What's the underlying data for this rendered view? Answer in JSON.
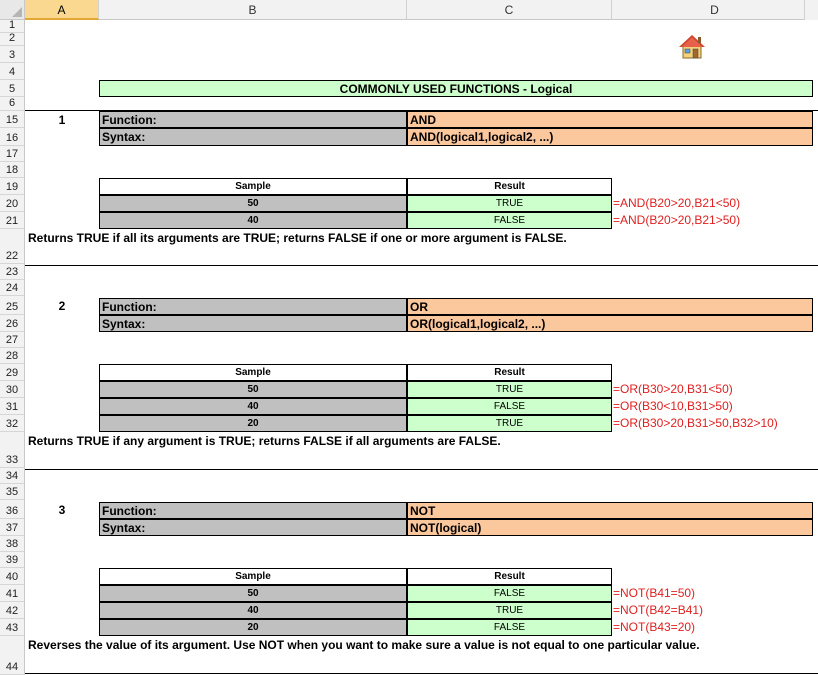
{
  "sheet": {
    "columns": [
      "A",
      "B",
      "C",
      "D"
    ],
    "selected_column": "A",
    "rows": [
      "1",
      "2",
      "3",
      "4",
      "5",
      "6",
      "15",
      "16",
      "17",
      "18",
      "19",
      "20",
      "21",
      "22",
      "23",
      "24",
      "25",
      "26",
      "27",
      "28",
      "29",
      "30",
      "31",
      "32",
      "33",
      "34",
      "35",
      "36",
      "37",
      "38",
      "39",
      "40",
      "41",
      "42",
      "43",
      "44"
    ]
  },
  "header_title": "COMMONLY USED FUNCTIONS - Logical",
  "home_icon": "house-icon",
  "labels": {
    "function": "Function:",
    "syntax": "Syntax:",
    "sample": "Sample",
    "result": "Result"
  },
  "sections": [
    {
      "number": "1",
      "function": "AND",
      "syntax": "AND(logical1,logical2, ...)",
      "rows": [
        {
          "sample": "50",
          "result": "TRUE",
          "formula": "=AND(B20>20,B21<50)"
        },
        {
          "sample": "40",
          "result": "FALSE",
          "formula": "=AND(B20>20,B21>50)"
        }
      ],
      "description": "Returns TRUE if all its arguments are TRUE; returns FALSE if one or more argument is FALSE."
    },
    {
      "number": "2",
      "function": "OR",
      "syntax": "OR(logical1,logical2, ...)",
      "rows": [
        {
          "sample": "50",
          "result": "TRUE",
          "formula": "=OR(B30>20,B31<50)"
        },
        {
          "sample": "40",
          "result": "FALSE",
          "formula": "=OR(B30<10,B31>50)"
        },
        {
          "sample": "20",
          "result": "TRUE",
          "formula": "=OR(B30>20,B31>50,B32>10)"
        }
      ],
      "description": "Returns TRUE if any argument is TRUE; returns FALSE if all arguments are FALSE."
    },
    {
      "number": "3",
      "function": "NOT",
      "syntax": "NOT(logical)",
      "rows": [
        {
          "sample": "50",
          "result": "FALSE",
          "formula": "=NOT(B41=50)"
        },
        {
          "sample": "40",
          "result": "TRUE",
          "formula": "=NOT(B42=B41)"
        },
        {
          "sample": "20",
          "result": "FALSE",
          "formula": "=NOT(B43=20)"
        }
      ],
      "description": "Reverses the value of its argument. Use NOT when you want to make sure a value is not equal to one particular value."
    }
  ],
  "colors": {
    "title_bg": "#ccffcc",
    "label_bg": "#c0c0c0",
    "value_bg": "#fbc79d",
    "result_bg": "#ccffcc",
    "formula_color": "#e02020"
  }
}
